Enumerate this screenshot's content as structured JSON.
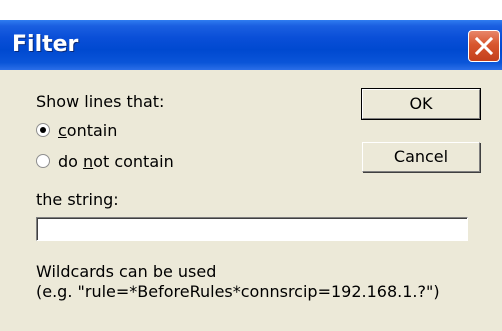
{
  "dialog": {
    "title": "Filter",
    "show_lines_label": "Show lines that:",
    "radio_contain": {
      "pre": "",
      "accel": "c",
      "post": "ontain",
      "selected": true
    },
    "radio_not_contain": {
      "pre": "do ",
      "accel": "n",
      "post": "ot contain",
      "selected": false
    },
    "string_label": "the string:",
    "string_value": "",
    "hint_line1": "Wildcards can be used",
    "hint_line2": "(e.g. \"rule=*BeforeRules*connsrcip=192.168.1.?\")",
    "ok_label": "OK",
    "cancel_label": "Cancel"
  },
  "icons": [
    "close-icon"
  ],
  "colors": {
    "titlebar": "#0a4fd8",
    "face": "#ece9d8",
    "close": "#d8562e"
  }
}
